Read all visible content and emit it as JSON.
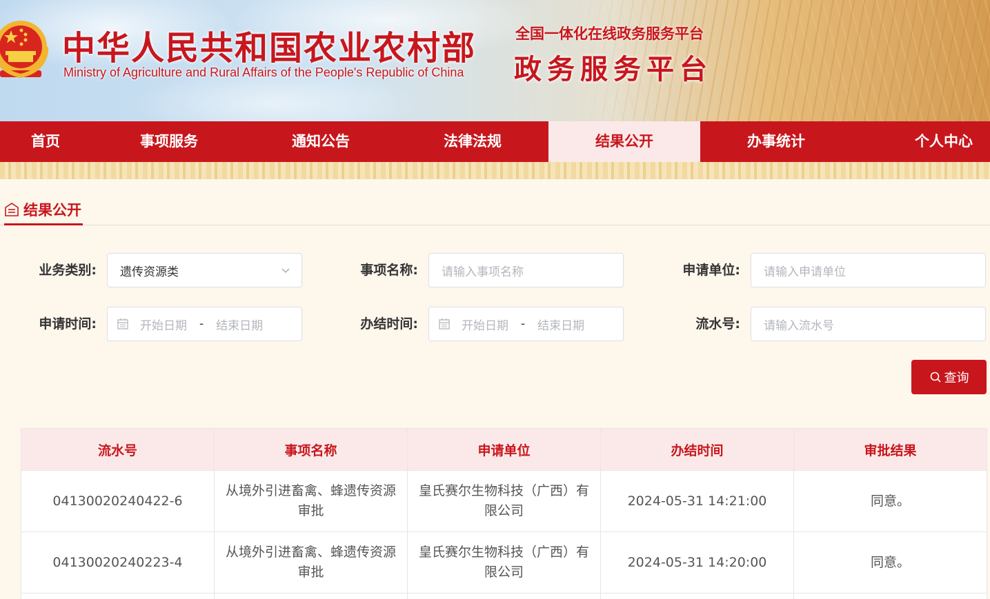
{
  "header": {
    "ministry_cn": "中华人民共和国农业农村部",
    "ministry_en": "Ministry of Agriculture and Rural Affairs of the People's Republic of China",
    "platform_subtitle": "全国一体化在线政务服务平台",
    "platform_title": "政务服务平台"
  },
  "nav": {
    "items": [
      {
        "label": "首页"
      },
      {
        "label": "事项服务"
      },
      {
        "label": "通知公告"
      },
      {
        "label": "法律法规"
      },
      {
        "label": "结果公开"
      },
      {
        "label": "办事统计"
      },
      {
        "label": "个人中心"
      }
    ],
    "active_index": 4
  },
  "section": {
    "title": "结果公开"
  },
  "filters": {
    "category_label": "业务类别:",
    "category_value": "遗传资源类",
    "item_name_label": "事项名称:",
    "item_name_placeholder": "请输入事项名称",
    "applicant_label": "申请单位:",
    "applicant_placeholder": "请输入申请单位",
    "apply_time_label": "申请时间:",
    "finish_time_label": "办结时间:",
    "start_placeholder": "开始日期",
    "end_placeholder": "结束日期",
    "date_separator": "-",
    "serial_label": "流水号:",
    "serial_placeholder": "请输入流水号",
    "search_label": "查询"
  },
  "table": {
    "headers": [
      "流水号",
      "事项名称",
      "申请单位",
      "办结时间",
      "审批结果"
    ],
    "rows": [
      {
        "serial": "04130020240422-6",
        "item": "从境外引进畜禽、蜂遗传资源审批",
        "applicant": "皇氏赛尔生物科技（广西）有限公司",
        "finish_time": "2024-05-31 14:21:00",
        "result": "同意。"
      },
      {
        "serial": "04130020240223-4",
        "item": "从境外引进畜禽、蜂遗传资源审批",
        "applicant": "皇氏赛尔生物科技（广西）有限公司",
        "finish_time": "2024-05-31 14:20:00",
        "result": "同意。"
      }
    ]
  },
  "colors": {
    "brand_red": "#c8161d",
    "active_tab_bg": "#fbe9e9",
    "table_header_bg": "#fbe9e9"
  },
  "icons": {
    "emblem": "national-emblem-icon",
    "section": "document-icon",
    "dropdown": "chevron-down-icon",
    "date": "calendar-icon",
    "search": "search-icon"
  }
}
